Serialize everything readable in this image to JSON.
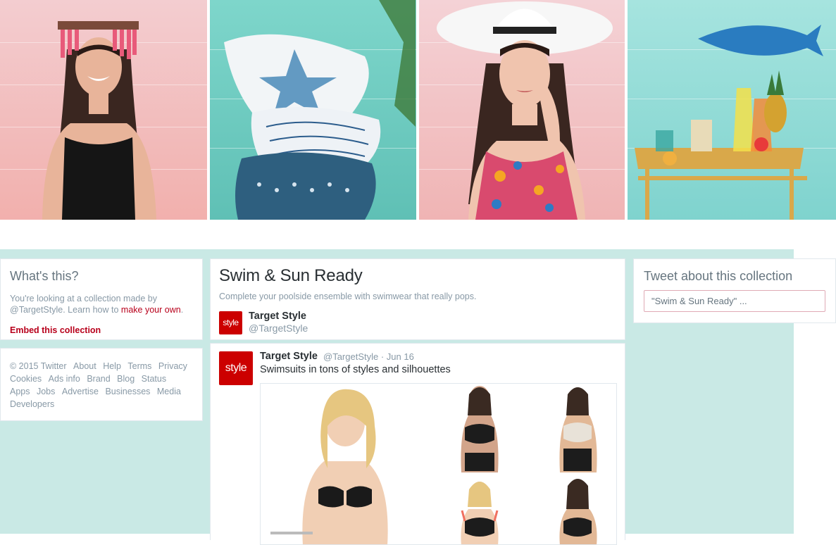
{
  "banner": {
    "images": [
      {
        "name": "model-with-fringe-hat-photo"
      },
      {
        "name": "starfish-pillows-photo"
      },
      {
        "name": "model-in-white-sunhat-photo"
      },
      {
        "name": "drink-cart-with-fish-plate-photo"
      }
    ]
  },
  "what_this": {
    "title": "What's this?",
    "text_prefix": "You're looking at a collection made by @TargetStyle. Learn how to ",
    "link": "make your own",
    "text_suffix": ".",
    "embed_label": "Embed this collection"
  },
  "footer": {
    "links": [
      "© 2015 Twitter",
      "About",
      "Help",
      "Terms",
      "Privacy",
      "Cookies",
      "Ads info",
      "Brand",
      "Blog",
      "Status",
      "Apps",
      "Jobs",
      "Advertise",
      "Businesses",
      "Media",
      "Developers"
    ]
  },
  "collection": {
    "title": "Swim & Sun Ready",
    "description": "Complete your poolside ensemble with swimwear that really pops.",
    "owner_name": "Target Style",
    "owner_handle": "@TargetStyle",
    "logo_text": "style"
  },
  "tweet": {
    "author": "Target Style",
    "meta": "@TargetStyle · Jun 16",
    "text": "Swimsuits in tons of styles and silhouettes",
    "logo_text": "style"
  },
  "tweet_about": {
    "title": "Tweet about this collection",
    "input_value": "\"Swim & Sun Ready\" ..."
  },
  "colors": {
    "accent": "#b8001b",
    "target_red": "#cc0000",
    "page_background": "#c9e9e5"
  }
}
